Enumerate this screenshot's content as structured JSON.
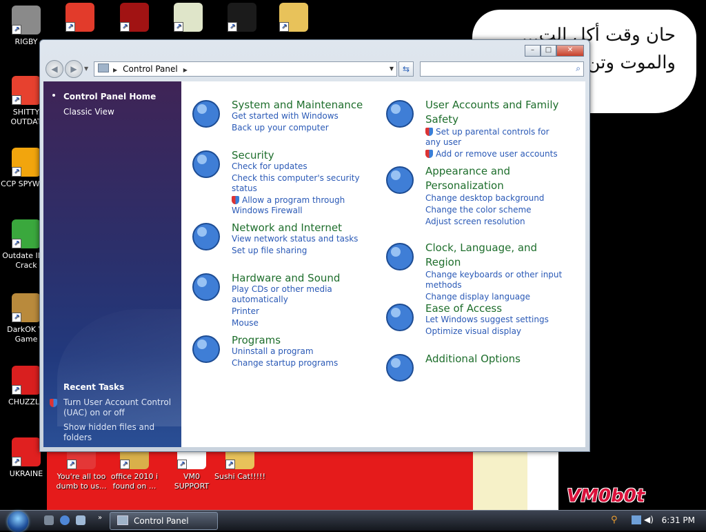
{
  "desktop": {
    "speech_lines": [
      "حان وقت أكل الت...",
      "والموت وتن..."
    ],
    "watermark": "VM0b0t",
    "icons_left": [
      {
        "label": "RIGBY",
        "icon": "raccoon-icon",
        "color": "#8a8a8a"
      },
      {
        "label": "SHITTY OUTDAT",
        "icon": "chrome-icon",
        "color": "#e7412f"
      },
      {
        "label": "CCP SPYWA...",
        "icon": "photos-icon",
        "color": "#f2a50d"
      },
      {
        "label": "Outdate IDM Crack",
        "icon": "idm-icon",
        "color": "#3aa83d"
      },
      {
        "label": "DarkOK Vi Game",
        "icon": "money-bag-icon",
        "color": "#b98a3c"
      },
      {
        "label": "CHUZZLE",
        "icon": "chuzzle-icon",
        "color": "#d91f1f"
      },
      {
        "label": "UKRAINE",
        "icon": "radiation-icon",
        "color": "#e02020"
      }
    ],
    "icons_top": [
      {
        "label": "",
        "icon": "p-app-icon",
        "color": "#e23b2b"
      },
      {
        "label": "",
        "icon": "flash-icon",
        "color": "#a11313"
      },
      {
        "label": "",
        "icon": "hxd-icon",
        "color": "#dfe5c9"
      },
      {
        "label": "",
        "icon": "console-icon",
        "color": "#1b1b1b"
      },
      {
        "label": "",
        "icon": "folder-zip-icon",
        "color": "#e8c25a"
      }
    ],
    "icons_bottom": [
      {
        "label": "You're all too dumb to us...",
        "icon": "notepadpp-icon",
        "color": "#e43737"
      },
      {
        "label": "office 2010 i found on ...",
        "icon": "archive-icon",
        "color": "#d9b04a"
      },
      {
        "label": "VM0 SUPPORT",
        "icon": "support-icon",
        "color": "#ffffff"
      },
      {
        "label": "Sushi Cat!!!!!",
        "icon": "folder-icon",
        "color": "#e8c25a"
      }
    ]
  },
  "window": {
    "title": "",
    "controls": {
      "minimize": "–",
      "maximize": "□",
      "close": "✕"
    },
    "breadcrumb": "Control Panel",
    "search_placeholder": "",
    "sidebar": {
      "home": "Control Panel Home",
      "classic": "Classic View",
      "recent_title": "Recent Tasks",
      "recent": [
        "Turn User Account Control (UAC) on or off",
        "Show hidden files and folders"
      ]
    },
    "categories_left": [
      {
        "title": "System and Maintenance",
        "icon": "system-maintenance-icon",
        "links": [
          {
            "text": "Get started with Windows",
            "shield": false
          },
          {
            "text": "Back up your computer",
            "shield": false
          }
        ]
      },
      {
        "title": "Security",
        "icon": "security-shield-icon",
        "links": [
          {
            "text": "Check for updates",
            "shield": false
          },
          {
            "text": "Check this computer's security status",
            "shield": false
          },
          {
            "text": "Allow a program through Windows Firewall",
            "shield": true
          }
        ]
      },
      {
        "title": "Network and Internet",
        "icon": "network-globe-icon",
        "links": [
          {
            "text": "View network status and tasks",
            "shield": false
          },
          {
            "text": "Set up file sharing",
            "shield": false
          }
        ]
      },
      {
        "title": "Hardware and Sound",
        "icon": "printer-icon",
        "links": [
          {
            "text": "Play CDs or other media automatically",
            "shield": false
          },
          {
            "text": "Printer",
            "shield": false
          },
          {
            "text": "Mouse",
            "shield": false
          }
        ]
      },
      {
        "title": "Programs",
        "icon": "programs-box-icon",
        "links": [
          {
            "text": "Uninstall a program",
            "shield": false
          },
          {
            "text": "Change startup programs",
            "shield": false
          }
        ]
      }
    ],
    "categories_right": [
      {
        "title": "User Accounts and Family Safety",
        "icon": "user-accounts-icon",
        "links": [
          {
            "text": "Set up parental controls for any user",
            "shield": true
          },
          {
            "text": "Add or remove user accounts",
            "shield": true
          }
        ]
      },
      {
        "title": "Appearance and Personalization",
        "icon": "appearance-monitor-icon",
        "links": [
          {
            "text": "Change desktop background",
            "shield": false
          },
          {
            "text": "Change the color scheme",
            "shield": false
          },
          {
            "text": "Adjust screen resolution",
            "shield": false
          }
        ]
      },
      {
        "title": "Clock, Language, and Region",
        "icon": "clock-globe-icon",
        "links": [
          {
            "text": "Change keyboards or other input methods",
            "shield": false
          },
          {
            "text": "Change display language",
            "shield": false
          }
        ]
      },
      {
        "title": "Ease of Access",
        "icon": "ease-of-access-icon",
        "links": [
          {
            "text": "Let Windows suggest settings",
            "shield": false
          },
          {
            "text": "Optimize visual display",
            "shield": false
          }
        ]
      },
      {
        "title": "Additional Options",
        "icon": "checklist-icon",
        "links": []
      }
    ]
  },
  "taskbar": {
    "active_task": "Control Panel",
    "clock": "6:31 PM"
  }
}
